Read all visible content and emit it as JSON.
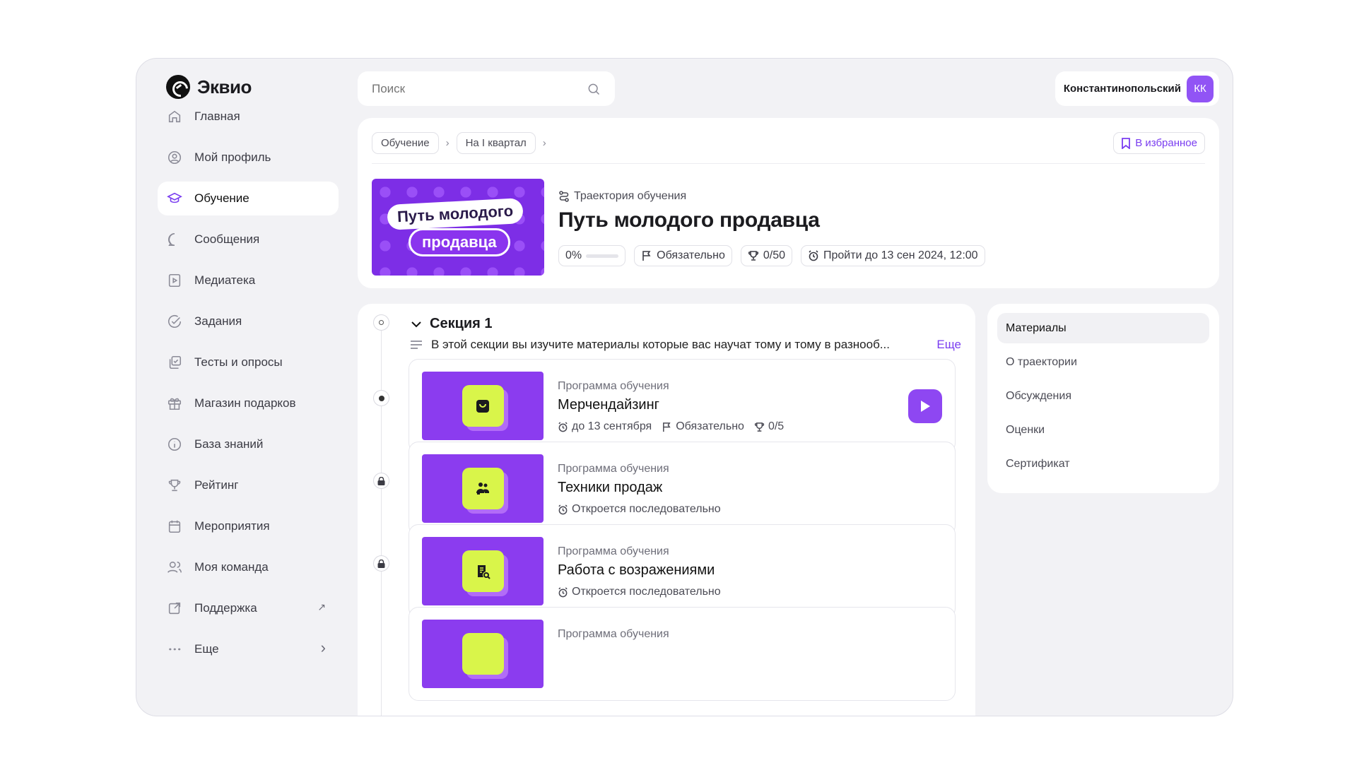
{
  "app": {
    "name": "Эквио"
  },
  "search": {
    "placeholder": "Поиск"
  },
  "user": {
    "name": "Константинопольский",
    "initials": "КК"
  },
  "sidebar": {
    "items": [
      {
        "label": "Главная",
        "icon": "home-icon"
      },
      {
        "label": "Мой профиль",
        "icon": "profile-icon"
      },
      {
        "label": "Обучение",
        "icon": "graduation-cap-icon",
        "active": true
      },
      {
        "label": "Сообщения",
        "icon": "chat-icon"
      },
      {
        "label": "Медиатека",
        "icon": "play-square-icon"
      },
      {
        "label": "Задания",
        "icon": "check-circle-icon"
      },
      {
        "label": "Тесты и опросы",
        "icon": "tests-icon"
      },
      {
        "label": "Магазин подарков",
        "icon": "gift-icon"
      },
      {
        "label": "База знаний",
        "icon": "info-icon"
      },
      {
        "label": "Рейтинг",
        "icon": "trophy-icon"
      },
      {
        "label": "Мероприятия",
        "icon": "calendar-icon"
      },
      {
        "label": "Моя команда",
        "icon": "team-icon"
      },
      {
        "label": "Поддержка",
        "icon": "external-link-icon",
        "tail": "↗"
      },
      {
        "label": "Еще",
        "icon": "more-dots-icon",
        "tail": "›"
      }
    ]
  },
  "breadcrumbs": [
    "Обучение",
    "На I квартал"
  ],
  "favorite_label": "В избранное",
  "trajectory": {
    "cover_line1": "Путь молодого",
    "cover_line2": "продавца",
    "kind": "Траектория обучения",
    "title": "Путь молодого продавца",
    "progress_text": "0%",
    "progress": 0,
    "required": "Обязательно",
    "score": "0/50",
    "deadline": "Пройти до 13 сен 2024, 12:00"
  },
  "section": {
    "title": "Секция 1",
    "description": "В этой секции вы изучите материалы которые вас научат тому и тому в разнооб...",
    "more": "Еще"
  },
  "items": [
    {
      "kind": "Программа обучения",
      "title": "Мерчендайзинг",
      "due": "до 13 сентября",
      "required": "Обязательно",
      "score": "0/5",
      "icon": "shopping-bag-icon",
      "state": "current"
    },
    {
      "kind": "Программа обучения",
      "title": "Техники продаж",
      "status": "Откроется последовательно",
      "icon": "people-icon",
      "state": "locked"
    },
    {
      "kind": "Программа обучения",
      "title": "Работа с возражениями",
      "status": "Откроется последовательно",
      "icon": "document-search-icon",
      "state": "locked"
    },
    {
      "kind": "Программа обучения",
      "title": "",
      "icon": "item-icon",
      "state": "locked"
    }
  ],
  "tabs": [
    "Материалы",
    "О траектории",
    "Обсуждения",
    "Оценки",
    "Сертификат"
  ],
  "colors": {
    "accent": "#7a3df0",
    "lime": "#d9f54a",
    "cover": "#7d2ee6"
  }
}
